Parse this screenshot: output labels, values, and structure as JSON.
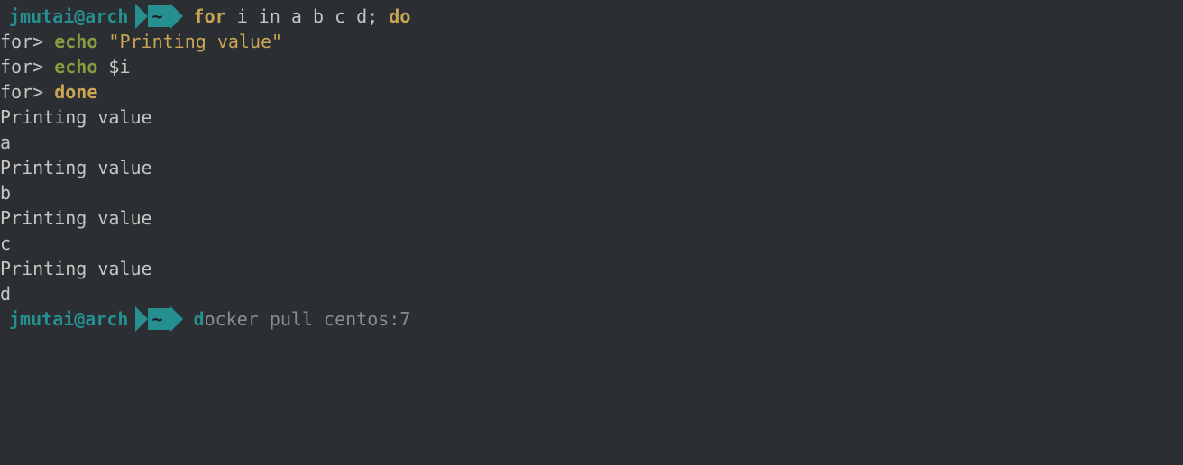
{
  "prompt": {
    "user_host": "jmutai@arch",
    "path": "~"
  },
  "colors": {
    "bg": "#2b2e33",
    "teal": "#268f8f",
    "olive": "#8a9a3f",
    "gold": "#c9a554",
    "fg": "#c6c7c0",
    "dim": "#8b8d86"
  },
  "cmd1": {
    "kw_for": "for",
    "vars": " i in a b c d; ",
    "kw_do": "do"
  },
  "cont": {
    "p1_prefix": "for>",
    "p1_cmd": "echo",
    "p1_arg": " \"Printing value\"",
    "p2_prefix": "for>",
    "p2_cmd": "echo",
    "p2_arg": " $i",
    "p3_prefix": "for>",
    "p3_kw": "done"
  },
  "output": [
    "Printing value",
    "a",
    "Printing value",
    "b",
    "Printing value",
    "c",
    "Printing value",
    "d"
  ],
  "cmd2": {
    "cursor_char": "d",
    "rest": "ocker pull centos:7"
  }
}
